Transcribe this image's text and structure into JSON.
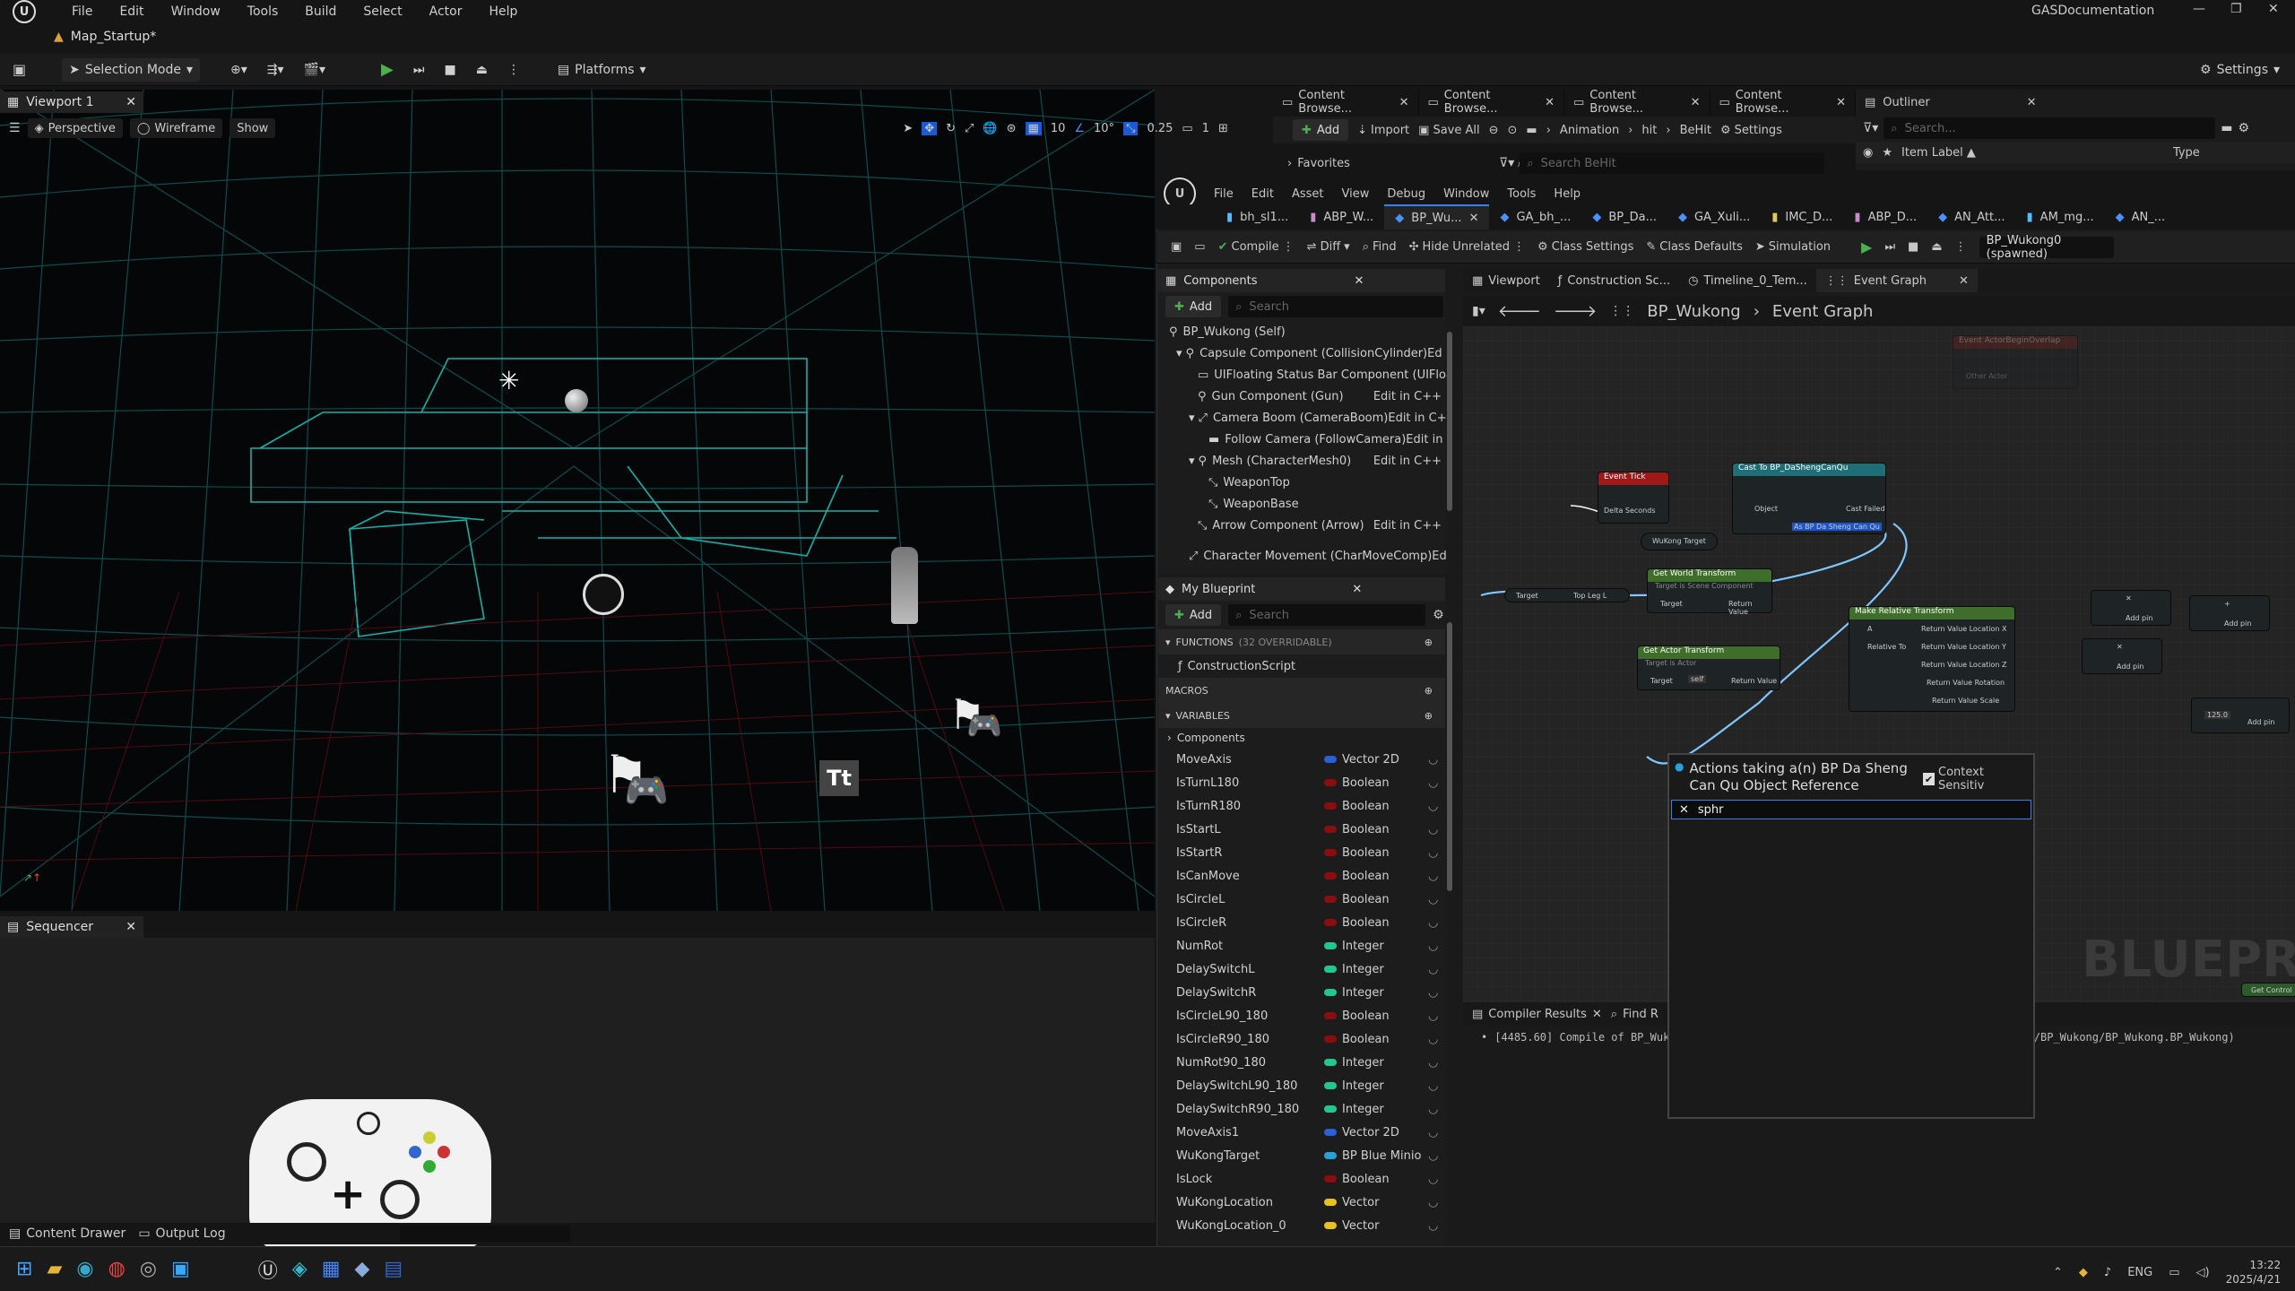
{
  "app": {
    "menu": [
      "File",
      "Edit",
      "Window",
      "Tools",
      "Build",
      "Select",
      "Actor",
      "Help"
    ],
    "project": "GASDocumentation",
    "map_tab": "Map_Startup*",
    "selection_mode": "Selection Mode",
    "platforms": "Platforms",
    "settings": "Settings"
  },
  "viewport": {
    "tab": "Viewport 1",
    "perspective": "Perspective",
    "wireframe": "Wireframe",
    "show": "Show",
    "grid_snap": "10",
    "rot_snap": "10°",
    "scale_snap": "0.25",
    "cam_speed": "1"
  },
  "sequencer": {
    "tab": "Sequencer"
  },
  "bottom": {
    "content_drawer": "Content Drawer",
    "output_log": "Output Log"
  },
  "content_browser": {
    "tabs": [
      "Content Browse...",
      "Content Browse...",
      "Content Browse...",
      "Content Browse..."
    ],
    "add": "Add",
    "import": "Import",
    "save_all": "Save All",
    "path": [
      "Animation",
      "hit",
      "BeHit"
    ],
    "settings": "Settings",
    "favorites": "Favorites",
    "search_placeholder": "Search BeHit"
  },
  "outliner": {
    "tab": "Outliner",
    "search_placeholder": "Search...",
    "col_label": "Item Label ▲",
    "col_type": "Type"
  },
  "bp_editor": {
    "menu": [
      "File",
      "Edit",
      "Asset",
      "View",
      "Debug",
      "Window",
      "Tools",
      "Help"
    ],
    "tabs": [
      "bh_sl1...",
      "ABP_W...",
      "BP_Wu...",
      "GA_bh_...",
      "BP_Da...",
      "GA_Xuli...",
      "IMC_D...",
      "ABP_D...",
      "AN_Att...",
      "AM_mg...",
      "AN_..."
    ],
    "toolbar": {
      "compile": "Compile",
      "diff": "Diff",
      "find": "Find",
      "hide_unrelated": "Hide Unrelated",
      "class_settings": "Class Settings",
      "class_defaults": "Class Defaults",
      "simulation": "Simulation",
      "debug_object": "BP_Wukong0 (spawned)"
    }
  },
  "components": {
    "title": "Components",
    "add": "Add",
    "search_placeholder": "Search",
    "items": [
      {
        "label": "BP_Wukong (Self)",
        "edit": ""
      },
      {
        "label": "Capsule Component (CollisionCylinder)",
        "edit": "Ed"
      },
      {
        "label": "UIFloating Status Bar Component (UIFloa",
        "edit": ""
      },
      {
        "label": "Gun Component (Gun)",
        "edit": "Edit in C++"
      },
      {
        "label": "Camera Boom (CameraBoom)",
        "edit": "Edit in C+"
      },
      {
        "label": "Follow Camera (FollowCamera)",
        "edit": "Edit in"
      },
      {
        "label": "Mesh (CharacterMesh0)",
        "edit": "Edit in C++"
      },
      {
        "label": "WeaponTop",
        "edit": ""
      },
      {
        "label": "WeaponBase",
        "edit": ""
      },
      {
        "label": "Arrow Component (Arrow)",
        "edit": "Edit in C++"
      },
      {
        "label": "Character Movement (CharMoveComp)",
        "edit": "Ed"
      }
    ]
  },
  "my_blueprint": {
    "title": "My Blueprint",
    "add": "Add",
    "search_placeholder": "Search",
    "functions": "FUNCTIONS",
    "functions_count": "(32 OVERRIDABLE)",
    "construction_script": "ConstructionScript",
    "macros": "MACROS",
    "variables": "VARIABLES",
    "components_cat": "Components",
    "vars": [
      {
        "name": "MoveAxis",
        "type": "Vector 2D",
        "color": "#2a5fd6"
      },
      {
        "name": "IsTurnL180",
        "type": "Boolean",
        "color": "#8c0d0d"
      },
      {
        "name": "IsTurnR180",
        "type": "Boolean",
        "color": "#8c0d0d"
      },
      {
        "name": "IsStartL",
        "type": "Boolean",
        "color": "#8c0d0d"
      },
      {
        "name": "IsStartR",
        "type": "Boolean",
        "color": "#8c0d0d"
      },
      {
        "name": "IsCanMove",
        "type": "Boolean",
        "color": "#8c0d0d"
      },
      {
        "name": "IsCircleL",
        "type": "Boolean",
        "color": "#8c0d0d"
      },
      {
        "name": "IsCircleR",
        "type": "Boolean",
        "color": "#8c0d0d"
      },
      {
        "name": "NumRot",
        "type": "Integer",
        "color": "#1fc88f"
      },
      {
        "name": "DelaySwitchL",
        "type": "Integer",
        "color": "#1fc88f"
      },
      {
        "name": "DelaySwitchR",
        "type": "Integer",
        "color": "#1fc88f"
      },
      {
        "name": "IsCircleL90_180",
        "type": "Boolean",
        "color": "#8c0d0d"
      },
      {
        "name": "IsCircleR90_180",
        "type": "Boolean",
        "color": "#8c0d0d"
      },
      {
        "name": "NumRot90_180",
        "type": "Integer",
        "color": "#1fc88f"
      },
      {
        "name": "DelaySwitchL90_180",
        "type": "Integer",
        "color": "#1fc88f"
      },
      {
        "name": "DelaySwitchR90_180",
        "type": "Integer",
        "color": "#1fc88f"
      },
      {
        "name": "MoveAxis1",
        "type": "Vector 2D",
        "color": "#2a5fd6"
      },
      {
        "name": "WuKongTarget",
        "type": "BP Blue Minio",
        "color": "#2aa1d6"
      },
      {
        "name": "IsLock",
        "type": "Boolean",
        "color": "#8c0d0d"
      },
      {
        "name": "WuKongLocation",
        "type": "Vector",
        "color": "#e6c21a"
      },
      {
        "name": "WuKongLocation_0",
        "type": "Vector",
        "color": "#e6c21a"
      }
    ]
  },
  "graph": {
    "tabs": [
      "Viewport",
      "Construction Sc...",
      "Timeline_0_Tem...",
      "Event Graph"
    ],
    "breadcrumb_bp": "BP_Wukong",
    "breadcrumb_graph": "Event Graph",
    "watermark": "BLUEPRIN",
    "nodes": {
      "event_tick": "Event Tick",
      "delta": "Delta Seconds",
      "cast": "Cast To BP_DaShengCanQu",
      "cast_object": "Object",
      "cast_failed": "Cast Failed",
      "cast_as": "As BP Da Sheng Can Qu",
      "wukong_target": "WuKong Target",
      "get_world": "Get World Transform",
      "get_world_sub": "Target is Scene Component",
      "target": "Target",
      "return_value": "Return Value",
      "top_leg": "Top Leg L",
      "get_actor": "Get Actor Transform",
      "get_actor_sub": "Target is Actor",
      "self": "self",
      "make_rel": "Make Relative Transform",
      "rel_a": "A",
      "rel_to": "Relative To",
      "rel_out": [
        "Return Value Location X",
        "Return Value Location Y",
        "Return Value Location Z",
        "Return Value Rotation",
        "Return Value Scale"
      ],
      "add_pin": "Add pin",
      "other_actor": "Other Actor",
      "faded": "Event ActorBeginOverlap",
      "small_val": "125.0",
      "get_control": "Get Control"
    }
  },
  "compiler": {
    "tab": "Compiler Results",
    "find_tab": "Find R",
    "log_start": "[4485.60] Compile of BP_Wuk",
    "log_end": "ng/BP_Wukong/BP_Wukong.BP_Wukong)"
  },
  "popup": {
    "title": "Actions taking a(n) BP Da Sheng Can Qu Object Reference",
    "context": "Context Sensitiv",
    "query": "sphr"
  },
  "taskbar": {
    "lang": "ENG",
    "time": "13:22",
    "date": "2025/4/21"
  }
}
